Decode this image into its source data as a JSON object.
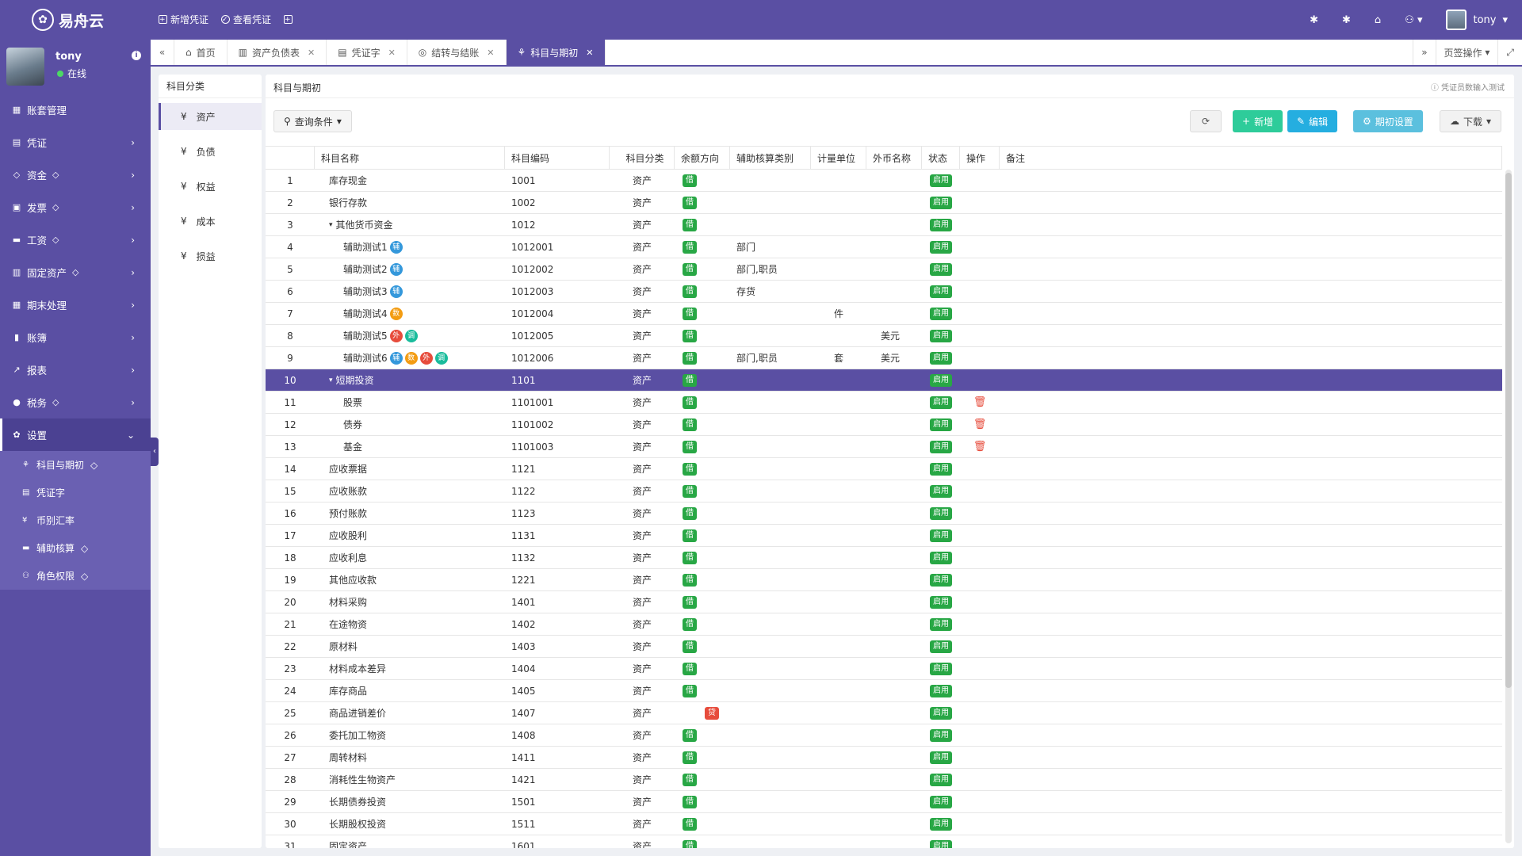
{
  "app": {
    "name": "易舟云",
    "logo_glyph": "✿"
  },
  "top_actions": {
    "new_voucher": "新增凭证",
    "view_voucher": "查看凭证"
  },
  "user": {
    "name": "tony",
    "status": "在线"
  },
  "sidebar": {
    "items": [
      {
        "label": "账套管理",
        "icon": "▦"
      },
      {
        "label": "凭证",
        "icon": "▤",
        "chev": "›"
      },
      {
        "label": "资金",
        "icon": "◇",
        "gem": "◇",
        "chev": "›"
      },
      {
        "label": "发票",
        "icon": "▣",
        "gem": "◇",
        "chev": "›"
      },
      {
        "label": "工资",
        "icon": "▬",
        "gem": "◇",
        "chev": "›"
      },
      {
        "label": "固定资产",
        "icon": "▥",
        "gem": "◇",
        "chev": "›"
      },
      {
        "label": "期末处理",
        "icon": "▦",
        "chev": "›"
      },
      {
        "label": "账簿",
        "icon": "▮",
        "chev": "›"
      },
      {
        "label": "报表",
        "icon": "↗",
        "chev": "›"
      },
      {
        "label": "税务",
        "icon": "●",
        "gem": "◇",
        "chev": "›"
      },
      {
        "label": "设置",
        "icon": "✿",
        "chev": "⌄"
      }
    ],
    "sub": [
      {
        "label": "科目与期初",
        "icon": "⚘",
        "gem": "◇"
      },
      {
        "label": "凭证字",
        "icon": "▤"
      },
      {
        "label": "币别汇率",
        "icon": "¥"
      },
      {
        "label": "辅助核算",
        "icon": "▬",
        "gem": "◇"
      },
      {
        "label": "角色权限",
        "icon": "⚇",
        "gem": "◇"
      }
    ]
  },
  "tabs": [
    {
      "label": "首页",
      "icon": "⌂",
      "close": ""
    },
    {
      "label": "资产负债表",
      "icon": "▥",
      "close": "✕"
    },
    {
      "label": "凭证字",
      "icon": "▤",
      "close": "✕"
    },
    {
      "label": "结转与结账",
      "icon": "◎",
      "close": "✕"
    },
    {
      "label": "科目与期初",
      "icon": "⚘",
      "close": "✕"
    }
  ],
  "tab_ops": "页签操作",
  "left_panel": {
    "title": "科目分类",
    "categories": [
      "资产",
      "负债",
      "权益",
      "成本",
      "损益"
    ]
  },
  "main": {
    "title": "科目与期初",
    "note": "凭证员数输入测试",
    "filter": "查询条件",
    "buttons": {
      "add": "新增",
      "edit": "编辑",
      "init": "期初设置",
      "download": "下载"
    }
  },
  "table": {
    "headers": [
      "科目名称",
      "科目编码",
      "科目分类",
      "余额方向",
      "辅助核算类别",
      "计量单位",
      "外币名称",
      "状态",
      "操作",
      "备注"
    ],
    "rows": [
      {
        "n": "1",
        "name": "库存现金",
        "code": "1001",
        "cat": "资产",
        "dir": "借",
        "status": "启用"
      },
      {
        "n": "2",
        "name": "银行存款",
        "code": "1002",
        "cat": "资产",
        "dir": "借",
        "status": "启用"
      },
      {
        "n": "3",
        "name": "其他货币资金",
        "code": "1012",
        "cat": "资产",
        "dir": "借",
        "status": "启用",
        "tree": "▾"
      },
      {
        "n": "4",
        "name": "辅助测试1",
        "code": "1012001",
        "cat": "资产",
        "dir": "借",
        "aux": "部门",
        "status": "启用",
        "child": true,
        "chips": [
          [
            "fu",
            "辅"
          ]
        ]
      },
      {
        "n": "5",
        "name": "辅助测试2",
        "code": "1012002",
        "cat": "资产",
        "dir": "借",
        "aux": "部门,职员",
        "status": "启用",
        "child": true,
        "chips": [
          [
            "fu",
            "辅"
          ]
        ]
      },
      {
        "n": "6",
        "name": "辅助测试3",
        "code": "1012003",
        "cat": "资产",
        "dir": "借",
        "aux": "存货",
        "status": "启用",
        "child": true,
        "chips": [
          [
            "fu",
            "辅"
          ]
        ]
      },
      {
        "n": "7",
        "name": "辅助测试4",
        "code": "1012004",
        "cat": "资产",
        "dir": "借",
        "unit": "件",
        "status": "启用",
        "child": true,
        "chips": [
          [
            "shu",
            "数"
          ]
        ]
      },
      {
        "n": "8",
        "name": "辅助测试5",
        "code": "1012005",
        "cat": "资产",
        "dir": "借",
        "cur": "美元",
        "status": "启用",
        "child": true,
        "chips": [
          [
            "wai",
            "外"
          ],
          [
            "tiao",
            "调"
          ]
        ]
      },
      {
        "n": "9",
        "name": "辅助测试6",
        "code": "1012006",
        "cat": "资产",
        "dir": "借",
        "aux": "部门,职员",
        "unit": "套",
        "cur": "美元",
        "status": "启用",
        "child": true,
        "chips": [
          [
            "fu",
            "辅"
          ],
          [
            "shu",
            "数"
          ],
          [
            "wai",
            "外"
          ],
          [
            "tiao",
            "调"
          ]
        ]
      },
      {
        "n": "10",
        "name": "短期投资",
        "code": "1101",
        "cat": "资产",
        "dir": "借",
        "status": "启用",
        "tree": "▾",
        "sel": true
      },
      {
        "n": "11",
        "name": "股票",
        "code": "1101001",
        "cat": "资产",
        "dir": "借",
        "status": "启用",
        "child": true,
        "del": true
      },
      {
        "n": "12",
        "name": "债券",
        "code": "1101002",
        "cat": "资产",
        "dir": "借",
        "status": "启用",
        "child": true,
        "del": true
      },
      {
        "n": "13",
        "name": "基金",
        "code": "1101003",
        "cat": "资产",
        "dir": "借",
        "status": "启用",
        "child": true,
        "del": true
      },
      {
        "n": "14",
        "name": "应收票据",
        "code": "1121",
        "cat": "资产",
        "dir": "借",
        "status": "启用"
      },
      {
        "n": "15",
        "name": "应收账款",
        "code": "1122",
        "cat": "资产",
        "dir": "借",
        "status": "启用"
      },
      {
        "n": "16",
        "name": "预付账款",
        "code": "1123",
        "cat": "资产",
        "dir": "借",
        "status": "启用"
      },
      {
        "n": "17",
        "name": "应收股利",
        "code": "1131",
        "cat": "资产",
        "dir": "借",
        "status": "启用"
      },
      {
        "n": "18",
        "name": "应收利息",
        "code": "1132",
        "cat": "资产",
        "dir": "借",
        "status": "启用"
      },
      {
        "n": "19",
        "name": "其他应收款",
        "code": "1221",
        "cat": "资产",
        "dir": "借",
        "status": "启用"
      },
      {
        "n": "20",
        "name": "材料采购",
        "code": "1401",
        "cat": "资产",
        "dir": "借",
        "status": "启用"
      },
      {
        "n": "21",
        "name": "在途物资",
        "code": "1402",
        "cat": "资产",
        "dir": "借",
        "status": "启用"
      },
      {
        "n": "22",
        "name": "原材料",
        "code": "1403",
        "cat": "资产",
        "dir": "借",
        "status": "启用"
      },
      {
        "n": "23",
        "name": "材料成本差异",
        "code": "1404",
        "cat": "资产",
        "dir": "借",
        "status": "启用"
      },
      {
        "n": "24",
        "name": "库存商品",
        "code": "1405",
        "cat": "资产",
        "dir": "借",
        "status": "启用"
      },
      {
        "n": "25",
        "name": "商品进销差价",
        "code": "1407",
        "cat": "资产",
        "dir": "贷",
        "status": "启用"
      },
      {
        "n": "26",
        "name": "委托加工物资",
        "code": "1408",
        "cat": "资产",
        "dir": "借",
        "status": "启用"
      },
      {
        "n": "27",
        "name": "周转材料",
        "code": "1411",
        "cat": "资产",
        "dir": "借",
        "status": "启用"
      },
      {
        "n": "28",
        "name": "消耗性生物资产",
        "code": "1421",
        "cat": "资产",
        "dir": "借",
        "status": "启用"
      },
      {
        "n": "29",
        "name": "长期债券投资",
        "code": "1501",
        "cat": "资产",
        "dir": "借",
        "status": "启用"
      },
      {
        "n": "30",
        "name": "长期股权投资",
        "code": "1511",
        "cat": "资产",
        "dir": "借",
        "status": "启用"
      },
      {
        "n": "31",
        "name": "固定资产",
        "code": "1601",
        "cat": "资产",
        "dir": "借",
        "status": "启用"
      }
    ]
  }
}
